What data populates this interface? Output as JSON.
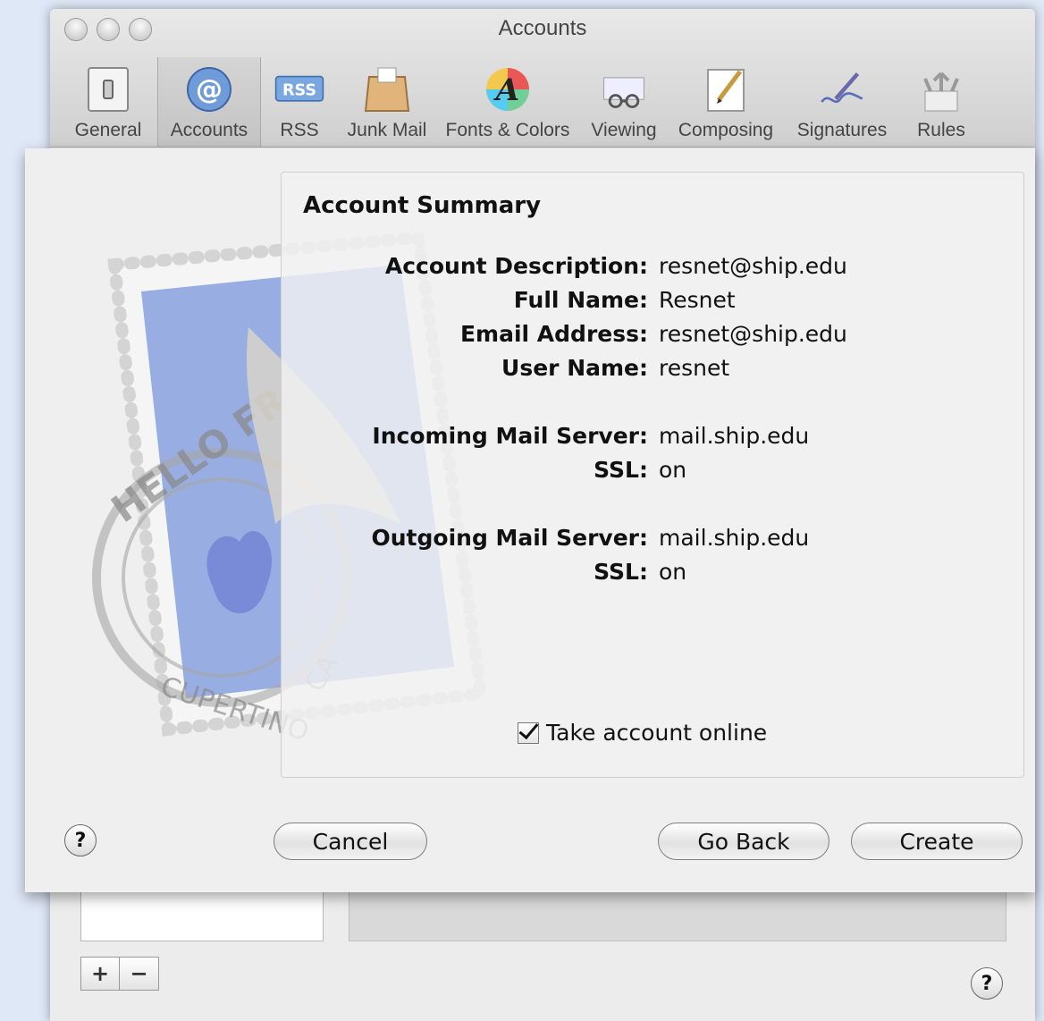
{
  "window": {
    "title": "Accounts"
  },
  "toolbar": {
    "items": [
      {
        "label": "General",
        "icon": "switch-icon"
      },
      {
        "label": "Accounts",
        "icon": "at-icon"
      },
      {
        "label": "RSS",
        "icon": "rss-icon"
      },
      {
        "label": "Junk Mail",
        "icon": "junk-mail-icon"
      },
      {
        "label": "Fonts & Colors",
        "icon": "fonts-colors-icon"
      },
      {
        "label": "Viewing",
        "icon": "viewing-icon"
      },
      {
        "label": "Composing",
        "icon": "composing-icon"
      },
      {
        "label": "Signatures",
        "icon": "signature-icon"
      },
      {
        "label": "Rules",
        "icon": "rules-icon"
      }
    ],
    "rss_badge": "RSS",
    "active": "Accounts"
  },
  "sheet": {
    "title": "Account Summary",
    "rows": [
      {
        "label": "Account Description:",
        "value": "resnet@ship.edu"
      },
      {
        "label": "Full Name:",
        "value": "Resnet"
      },
      {
        "label": "Email Address:",
        "value": "resnet@ship.edu"
      },
      {
        "label": "User Name:",
        "value": "resnet"
      },
      {
        "label": "Incoming Mail Server:",
        "value": "mail.ship.edu"
      },
      {
        "label": "SSL:",
        "value": "on"
      },
      {
        "label": "Outgoing Mail Server:",
        "value": "mail.ship.edu"
      },
      {
        "label": "SSL:",
        "value": "on"
      }
    ],
    "checkbox_label": "Take account online",
    "checkbox_checked": true,
    "stamp_text_top": "HELLO FR",
    "stamp_text_bottom": "CUPERTINO",
    "stamp_text_side": "CA",
    "help": "?",
    "buttons": {
      "cancel": "Cancel",
      "go_back": "Go Back",
      "create": "Create"
    }
  },
  "bottom": {
    "add": "+",
    "remove": "−",
    "help": "?"
  }
}
